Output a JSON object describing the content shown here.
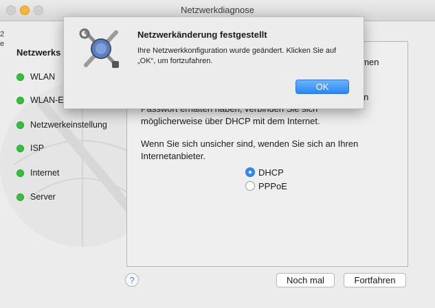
{
  "window": {
    "title": "Netzwerkdiagnose"
  },
  "sidebar": {
    "heading": "Netzwerks",
    "edge_top": "2",
    "edge_bottom": "e",
    "steps": [
      {
        "label": "WLAN",
        "status": "green"
      },
      {
        "label": "WLAN-Ei",
        "status": "green"
      },
      {
        "label": "Netzwerkeinstellung",
        "status": "green"
      },
      {
        "label": "ISP",
        "status": "green"
      },
      {
        "label": "Internet",
        "status": "green"
      },
      {
        "label": "Server",
        "status": "green"
      }
    ]
  },
  "content": {
    "clipped_1": "amen",
    "clipped_2": "u",
    "clipped_3": "ein",
    "paragraph1": "Passwort erhalten haben, verbinden Sie sich möglicherweise über DHCP mit dem Internet.",
    "paragraph2": "Wenn Sie sich unsicher sind, wenden Sie sich an Ihren Internetanbieter.",
    "options": [
      {
        "label": "DHCP",
        "selected": true
      },
      {
        "label": "PPPoE",
        "selected": false
      }
    ]
  },
  "footer": {
    "help_label": "?",
    "retry_label": "Noch mal",
    "continue_label": "Fortfahren"
  },
  "dialog": {
    "title": "Netzwerkänderung festgestellt",
    "message": "Ihre Netzwerkkonfiguration wurde geändert. Klicken Sie auf „OK“, um fortzufahren.",
    "ok_label": "OK",
    "icon": "network-utility-icon"
  },
  "colors": {
    "status_green": "#35c040",
    "accent_blue": "#2a86f4"
  }
}
